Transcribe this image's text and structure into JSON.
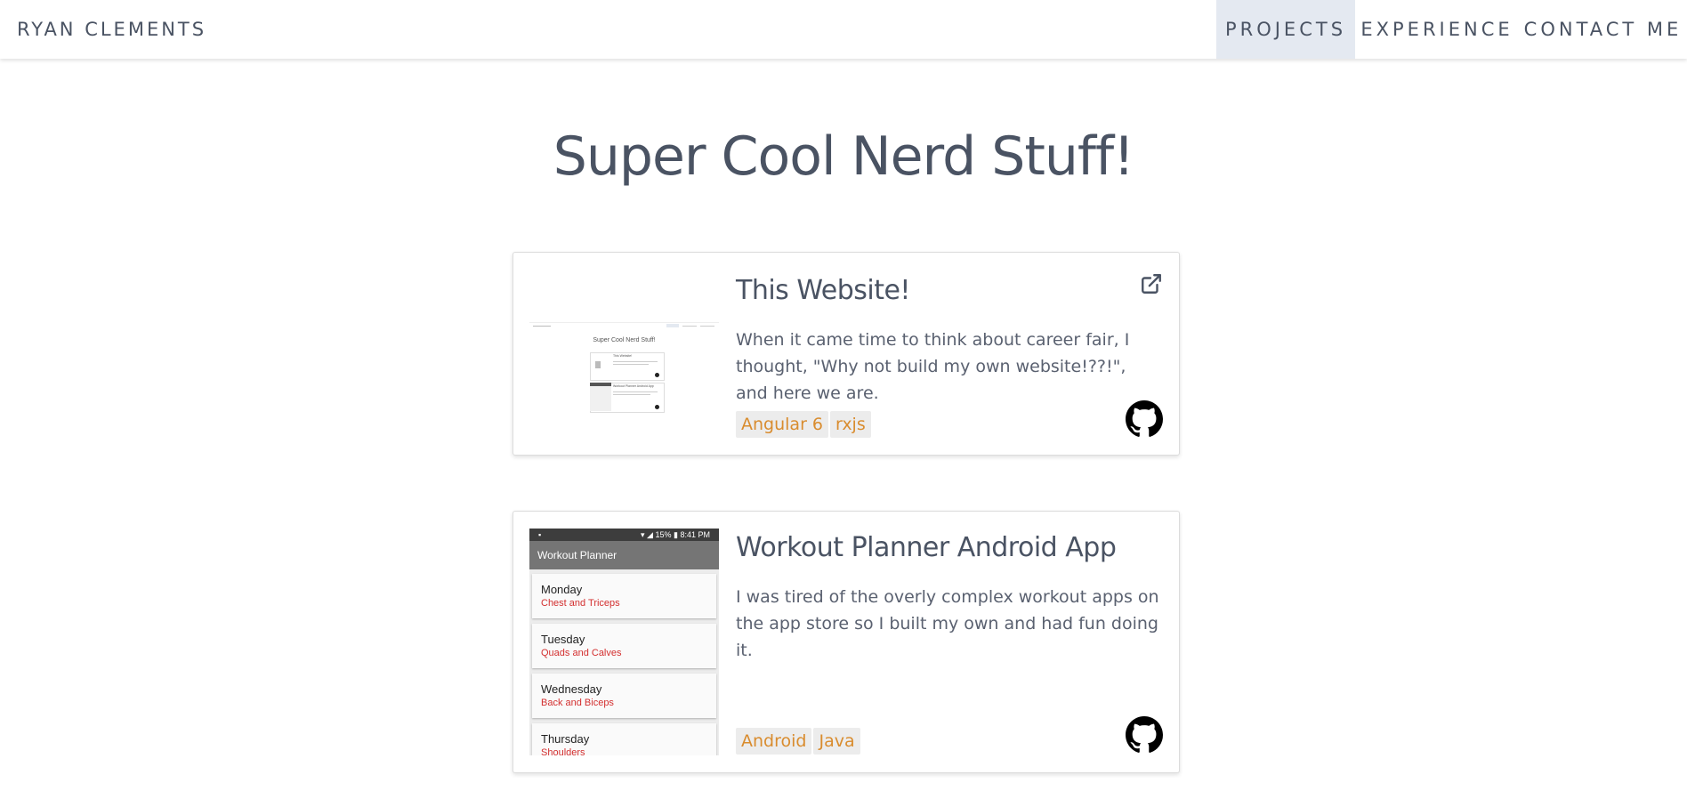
{
  "navbar": {
    "brand": "RYAN CLEMENTS",
    "items": [
      {
        "label": "PROJECTS",
        "active": true
      },
      {
        "label": "EXPERIENCE",
        "active": false
      },
      {
        "label": "CONTACT ME",
        "active": false
      }
    ]
  },
  "page": {
    "title": "Super Cool Nerd Stuff!"
  },
  "projects": [
    {
      "title": "This Website!",
      "description": "When it came time to think about career fair, I thought, \"Why not build my own website!??!\", and here we are.",
      "tags": [
        "Angular 6",
        "rxjs"
      ],
      "icons": [
        "external-link-icon",
        "github-icon"
      ],
      "thumbnail": {
        "title": "Super Cool Nerd Stuff!",
        "card1_title": "This Website!",
        "card2_title": "Workout Planner Android App"
      }
    },
    {
      "title": "Workout Planner Android App",
      "description": "I was tired of the overly complex workout apps on the app store so I built my own and had fun doing it.",
      "tags": [
        "Android",
        "Java"
      ],
      "icons": [
        "github-icon"
      ],
      "thumbnail": {
        "status_time": "8:41 PM",
        "status_battery": "15%",
        "app_title": "Workout Planner",
        "days": [
          {
            "day": "Monday",
            "muscles": "Chest and Triceps"
          },
          {
            "day": "Tuesday",
            "muscles": "Quads and Calves"
          },
          {
            "day": "Wednesday",
            "muscles": "Back and Biceps"
          },
          {
            "day": "Thursday",
            "muscles": "Shoulders"
          }
        ]
      }
    }
  ],
  "colors": {
    "text": "#4a5363",
    "active_nav_bg": "#e4e9f1",
    "tag_bg": "#ececec",
    "tag_text": "#d98c2e",
    "muscle_red": "#d32f2f"
  }
}
